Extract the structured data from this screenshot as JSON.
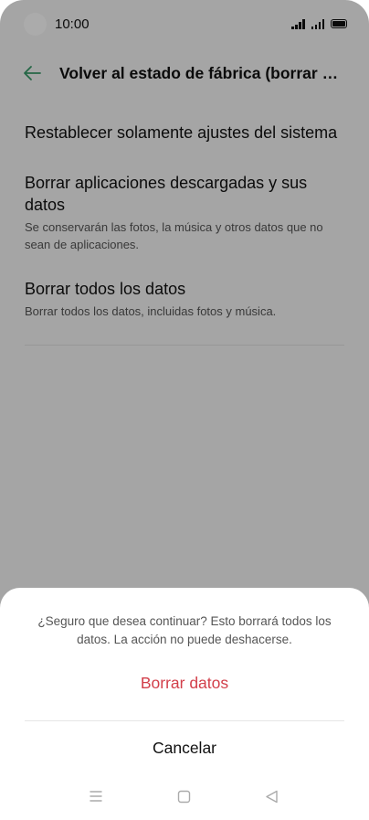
{
  "status_bar": {
    "time": "10:00"
  },
  "header": {
    "title": "Volver al estado de fábrica (borrar to..."
  },
  "options": [
    {
      "title": "Restablecer solamente ajustes del sistema",
      "description": ""
    },
    {
      "title": "Borrar aplicaciones descargadas y sus datos",
      "description": "Se conservarán las fotos, la música y otros datos que no sean de aplicaciones."
    },
    {
      "title": "Borrar todos los datos",
      "description": "Borrar todos los datos, incluidas fotos y música."
    }
  ],
  "dialog": {
    "message": "¿Seguro que desea continuar? Esto borrará todos los datos. La acción no puede deshacerse.",
    "confirm_label": "Borrar datos",
    "cancel_label": "Cancelar"
  },
  "colors": {
    "accent": "#3a9a6a",
    "danger": "#d23f4a"
  },
  "icons": {
    "back": "back-arrow-icon",
    "nav_menu": "menu-icon",
    "nav_home": "home-icon",
    "nav_back": "back-triangle-icon"
  }
}
